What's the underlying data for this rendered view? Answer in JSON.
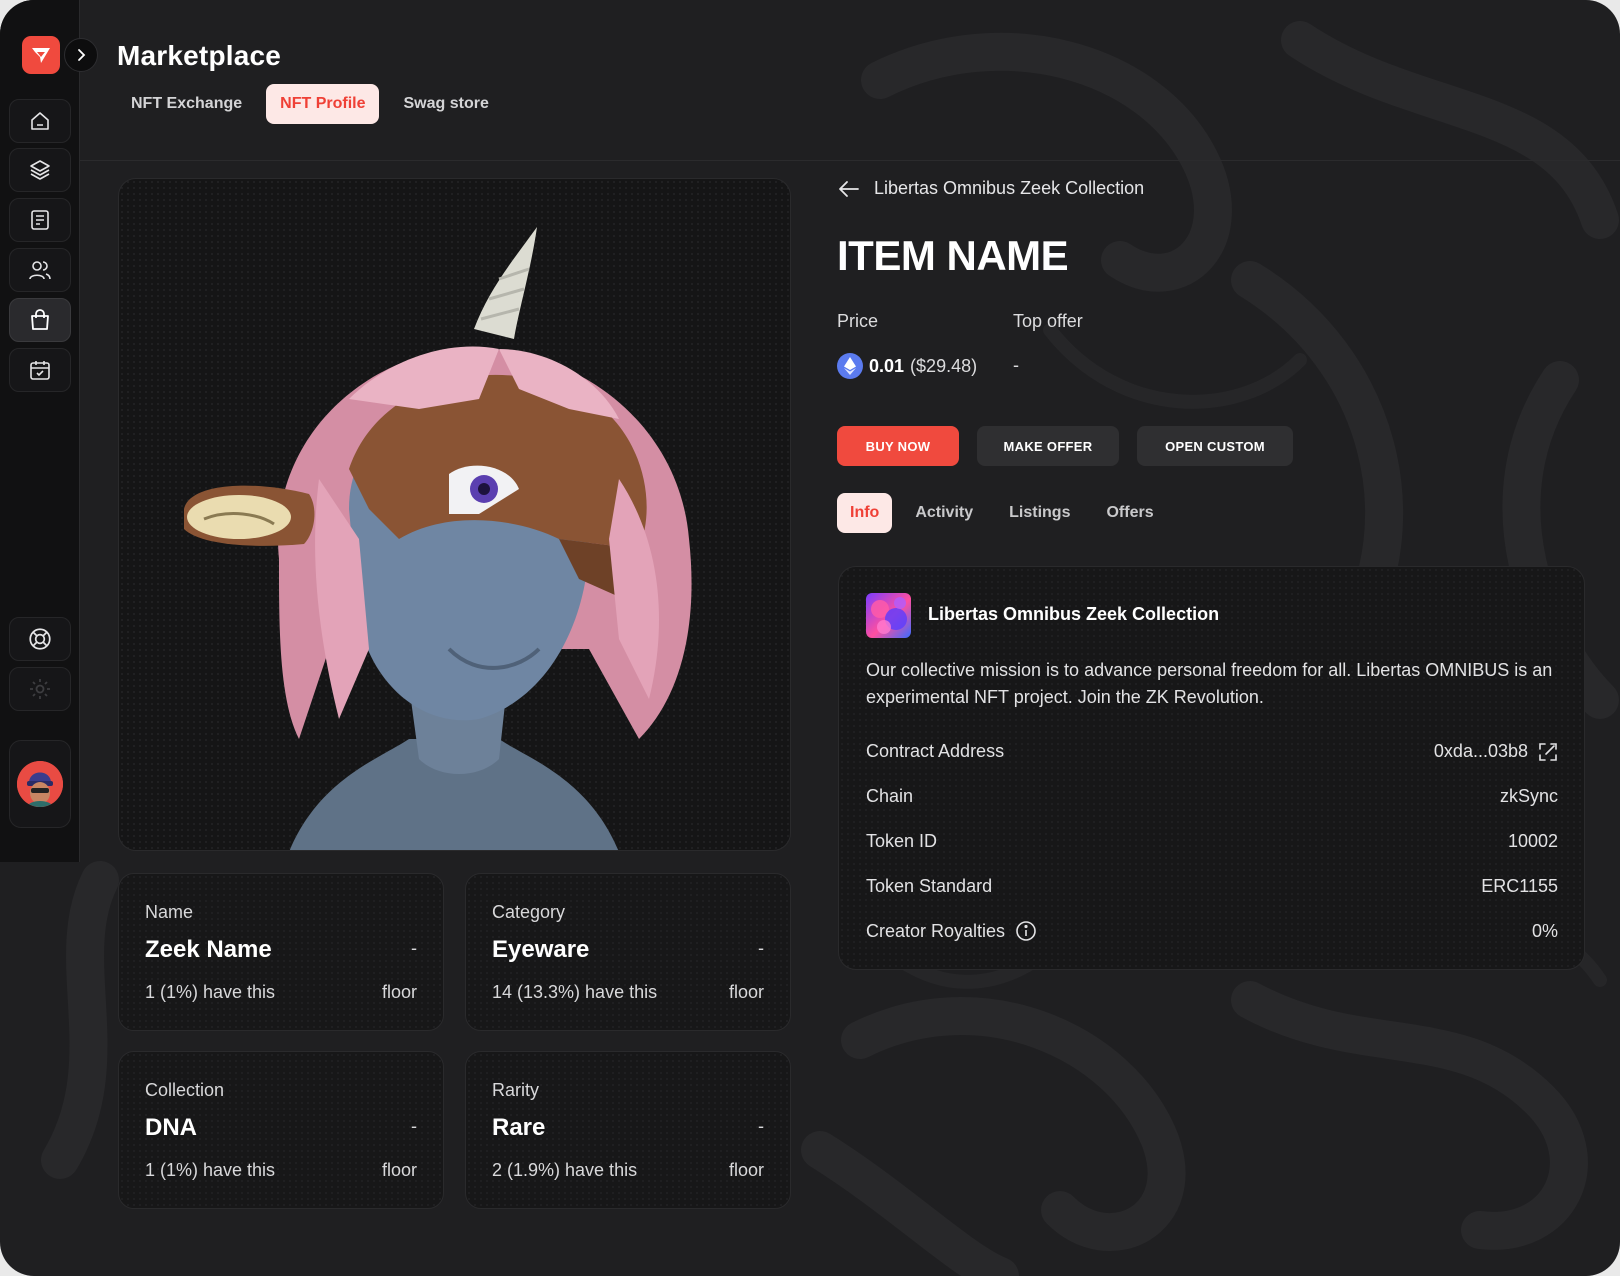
{
  "header": {
    "title": "Marketplace",
    "tabs": [
      {
        "label": "NFT Exchange",
        "active": false
      },
      {
        "label": "NFT Profile",
        "active": true
      },
      {
        "label": "Swag store",
        "active": false
      }
    ]
  },
  "sidebar": {
    "items": [
      {
        "icon": "home-icon"
      },
      {
        "icon": "layers-icon"
      },
      {
        "icon": "document-icon"
      },
      {
        "icon": "users-icon"
      },
      {
        "icon": "shopping-bag-icon",
        "active": true
      },
      {
        "icon": "calendar-check-icon"
      },
      {
        "icon": "lifebuoy-icon"
      },
      {
        "icon": "gear-icon"
      }
    ]
  },
  "item": {
    "back_label": "Libertas Omnibus Zeek Collection",
    "name": "ITEM NAME",
    "price_label": "Price",
    "price_value": "0.01",
    "price_usd": "($29.48)",
    "top_offer_label": "Top offer",
    "top_offer_value": "-"
  },
  "actions": {
    "buy": "BUY NOW",
    "offer": "MAKE OFFER",
    "custom": "OPEN CUSTOM"
  },
  "info_tabs": [
    {
      "label": "Info",
      "active": true
    },
    {
      "label": "Activity",
      "active": false
    },
    {
      "label": "Listings",
      "active": false
    },
    {
      "label": "Offers",
      "active": false
    }
  ],
  "collection": {
    "name": "Libertas Omnibus Zeek Collection",
    "description": "Our collective mission is to advance personal freedom for all. Libertas OMNIBUS is an experimental NFT project. Join the ZK Revolution.",
    "details": [
      {
        "key": "Contract Address",
        "value": "0xda...03b8"
      },
      {
        "key": "Chain",
        "value": "zkSync"
      },
      {
        "key": "Token ID",
        "value": "10002"
      },
      {
        "key": "Token Standard",
        "value": "ERC1155"
      },
      {
        "key": "Creator Royalties",
        "value": "0%"
      }
    ]
  },
  "traits": [
    {
      "label": "Name",
      "value": "Zeek Name",
      "dash": "-",
      "have": "1 (1%) have this",
      "floor": "floor"
    },
    {
      "label": "Category",
      "value": "Eyeware",
      "dash": "-",
      "have": "14 (13.3%) have this",
      "floor": "floor"
    },
    {
      "label": "Collection",
      "value": "DNA",
      "dash": "-",
      "have": "1 (1%) have this",
      "floor": "floor"
    },
    {
      "label": "Rarity",
      "value": "Rare",
      "dash": "-",
      "have": "2 (1.9%) have this",
      "floor": "floor"
    }
  ],
  "colors": {
    "accent": "#f04a3e",
    "accent_soft": "#fde8e6",
    "background": "#1f1f21",
    "sidebar": "#111112"
  }
}
